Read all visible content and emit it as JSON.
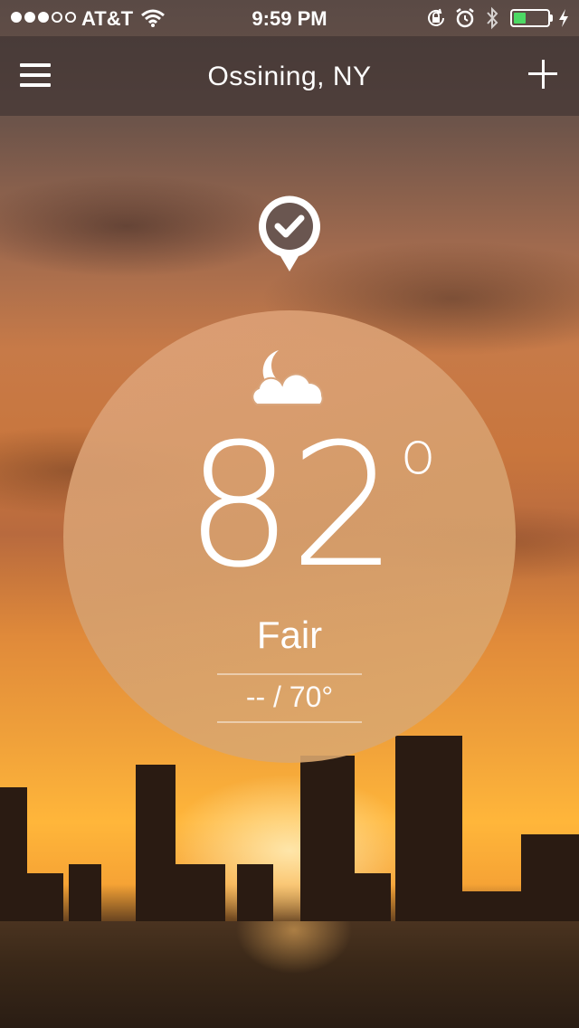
{
  "status_bar": {
    "signal_bars_filled": 3,
    "signal_bars_total": 5,
    "carrier": "AT&T",
    "time": "9:59 PM",
    "battery_level": 0.35,
    "icons": [
      "wifi-icon",
      "rotation-lock-icon",
      "alarm-icon",
      "bluetooth-icon",
      "battery-icon",
      "charging-icon"
    ]
  },
  "nav": {
    "title": "Ossining, NY",
    "left_icon": "menu-icon",
    "right_icon": "add-icon"
  },
  "location_pin_icon": "location-check-icon",
  "weather": {
    "condition_icon": "moon-cloud-icon",
    "temperature": "82",
    "degree_symbol": "o",
    "condition": "Fair",
    "hi_lo": "-- / 70°"
  },
  "colors": {
    "battery_green": "#4cd964",
    "circle_fill": "#dea078"
  }
}
